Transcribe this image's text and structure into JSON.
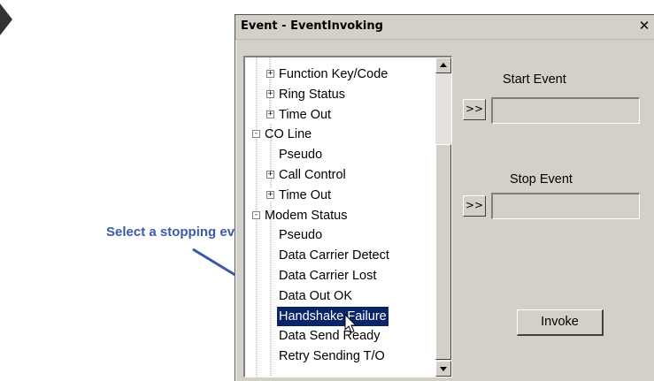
{
  "annotation": {
    "text": "Select a stopping event.",
    "color": "#3a5aa8"
  },
  "dialog": {
    "title": "Event - EventInvoking",
    "close_glyph": "✕",
    "tree": {
      "items": [
        {
          "label": "Function Key/Code",
          "expander": "+"
        },
        {
          "label": "Ring Status",
          "expander": "+"
        },
        {
          "label": "Time Out",
          "expander": "+"
        },
        {
          "label": "CO Line",
          "expander": "-"
        },
        {
          "label": "Pseudo",
          "expander": ""
        },
        {
          "label": "Call Control",
          "expander": "+"
        },
        {
          "label": "Time Out",
          "expander": "+"
        },
        {
          "label": "Modem Status",
          "expander": "-"
        },
        {
          "label": "Pseudo",
          "expander": ""
        },
        {
          "label": "Data Carrier Detect",
          "expander": ""
        },
        {
          "label": "Data Carrier Lost",
          "expander": ""
        },
        {
          "label": "Data Out OK",
          "expander": ""
        },
        {
          "label": "Handshake Failure",
          "expander": "",
          "selected": true
        },
        {
          "label": "Data Send Ready",
          "expander": ""
        },
        {
          "label": "Retry Sending T/O",
          "expander": ""
        }
      ]
    },
    "start_event": {
      "label": "Start Event",
      "button": ">>",
      "value": ""
    },
    "stop_event": {
      "label": "Stop Event",
      "button": ">>",
      "value": ""
    },
    "invoke_label": "Invoke",
    "selection_color": "#0a246a"
  }
}
